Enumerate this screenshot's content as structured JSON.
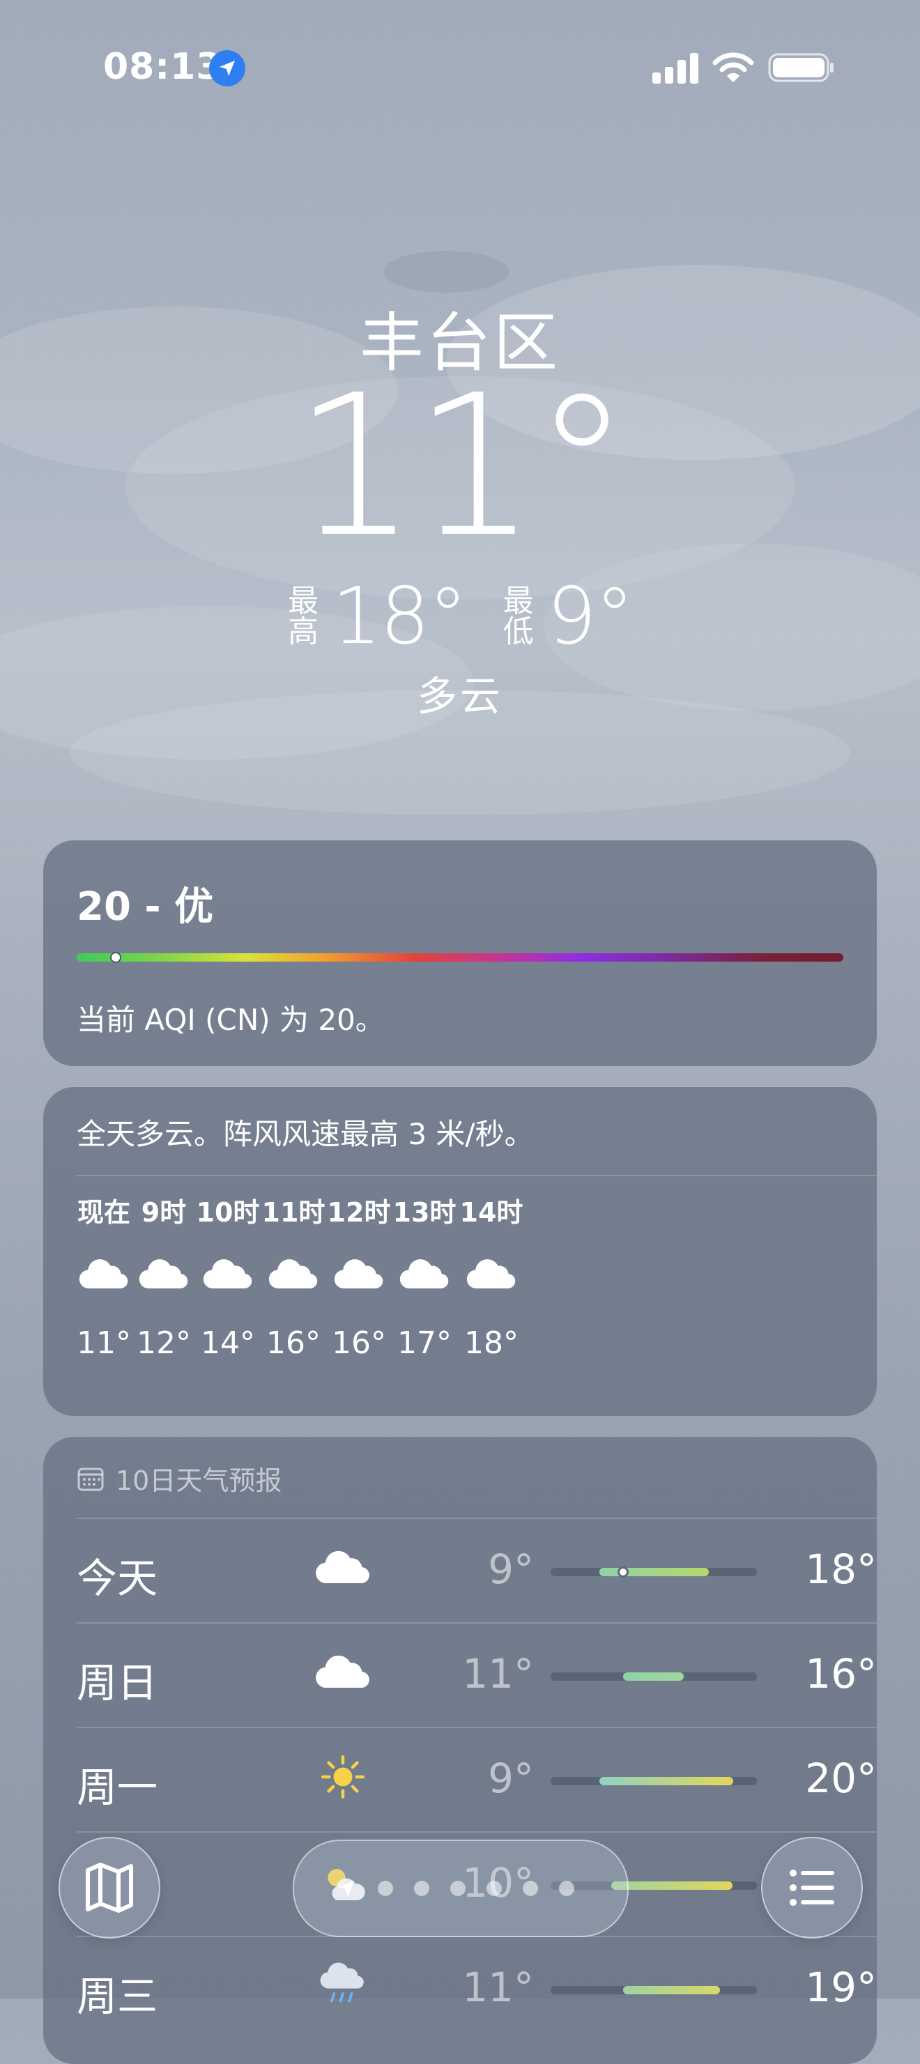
{
  "status_bar": {
    "time": "08:13"
  },
  "location": {
    "city": "丰台区",
    "current_temp": "11°",
    "high_label": "最高",
    "high_value": "18°",
    "low_label": "最低",
    "low_value": "9°",
    "condition": "多云"
  },
  "aqi": {
    "headline": "20 - 优",
    "value": 20,
    "description": "当前 AQI (CN) 为 20。"
  },
  "hourly": {
    "summary": "全天多云。阵风风速最高 3 米/秒。",
    "hours": [
      {
        "label": "现在",
        "icon": "cloud-icon",
        "temp": "11°"
      },
      {
        "label": "9时",
        "icon": "cloud-icon",
        "temp": "12°"
      },
      {
        "label": "10时",
        "icon": "cloud-icon",
        "temp": "14°"
      },
      {
        "label": "11时",
        "icon": "cloud-icon",
        "temp": "16°"
      },
      {
        "label": "12时",
        "icon": "cloud-icon",
        "temp": "16°"
      },
      {
        "label": "13时",
        "icon": "cloud-icon",
        "temp": "17°"
      },
      {
        "label": "14时",
        "icon": "cloud-icon",
        "temp": "18°"
      }
    ]
  },
  "forecast": {
    "title": "10日天气预报",
    "days": [
      {
        "day": "今天",
        "icon": "cloud-icon",
        "low": "9°",
        "high": "18°"
      },
      {
        "day": "周日",
        "icon": "cloud-icon",
        "low": "11°",
        "high": "16°"
      },
      {
        "day": "周一",
        "icon": "sun-icon",
        "low": "9°",
        "high": "20°"
      },
      {
        "day": "",
        "icon": "partly-sunny-icon",
        "low": "10°",
        "high": ""
      },
      {
        "day": "周三",
        "icon": "rain-cloud-icon",
        "low": "11°",
        "high": "19°"
      }
    ]
  },
  "colors": {
    "location_dot": "#2f7ff3",
    "card_bg": "#687284"
  }
}
